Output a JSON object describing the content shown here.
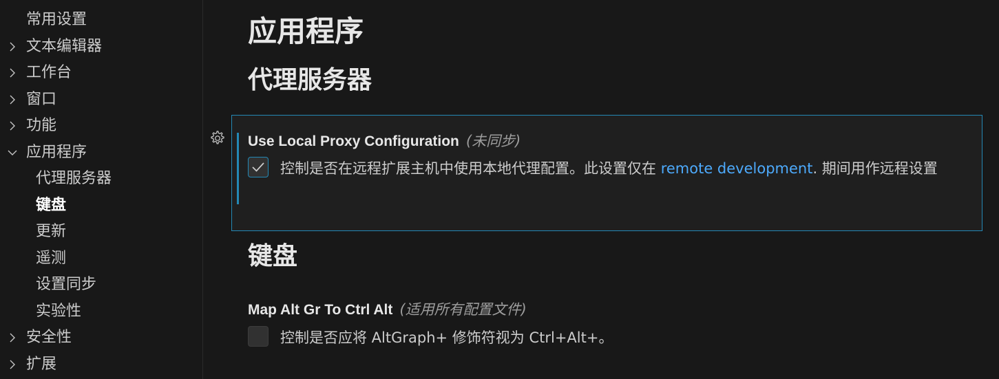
{
  "toc": {
    "items": [
      {
        "label": "常用设置",
        "chevron": "none",
        "level": 0,
        "bold": false
      },
      {
        "label": "文本编辑器",
        "chevron": "right",
        "level": 0,
        "bold": false
      },
      {
        "label": "工作台",
        "chevron": "right",
        "level": 0,
        "bold": false
      },
      {
        "label": "窗口",
        "chevron": "right",
        "level": 0,
        "bold": false
      },
      {
        "label": "功能",
        "chevron": "right",
        "level": 0,
        "bold": false
      },
      {
        "label": "应用程序",
        "chevron": "down",
        "level": 0,
        "bold": false
      },
      {
        "label": "代理服务器",
        "chevron": "none",
        "level": 1,
        "bold": false
      },
      {
        "label": "键盘",
        "chevron": "none",
        "level": 1,
        "bold": true
      },
      {
        "label": "更新",
        "chevron": "none",
        "level": 1,
        "bold": false
      },
      {
        "label": "遥测",
        "chevron": "none",
        "level": 1,
        "bold": false
      },
      {
        "label": "设置同步",
        "chevron": "none",
        "level": 1,
        "bold": false
      },
      {
        "label": "实验性",
        "chevron": "none",
        "level": 1,
        "bold": false
      },
      {
        "label": "安全性",
        "chevron": "right",
        "level": 0,
        "bold": false
      },
      {
        "label": "扩展",
        "chevron": "right",
        "level": 0,
        "bold": false
      }
    ]
  },
  "main": {
    "section_title": "应用程序",
    "proxy_heading": "代理服务器",
    "keyboard_heading": "键盘"
  },
  "settings": {
    "proxy": {
      "name": "Use Local Proxy Configuration",
      "scope": "(未同步)",
      "checked": true,
      "desc_before": "控制是否在远程扩展主机中使用本地代理配置。此设置仅在 ",
      "desc_link": "remote development",
      "desc_after": ". 期间用作远程设置"
    },
    "altgr": {
      "name": "Map Alt Gr To Ctrl Alt",
      "scope": "(适用所有配置文件)",
      "checked": false,
      "desc": "控制是否应将 AltGraph+ 修饰符视为 Ctrl+Alt+。"
    }
  },
  "icons": {
    "gear": "gear-icon",
    "check": "check-icon",
    "chevron_right": "chevron-right-icon",
    "chevron_down": "chevron-down-icon"
  },
  "colors": {
    "background": "#181818",
    "card_background": "#1f1f1f",
    "focus_border": "#2489b6",
    "link": "#4daafc",
    "heading": "#e7e7e7",
    "text": "#cccccc"
  }
}
